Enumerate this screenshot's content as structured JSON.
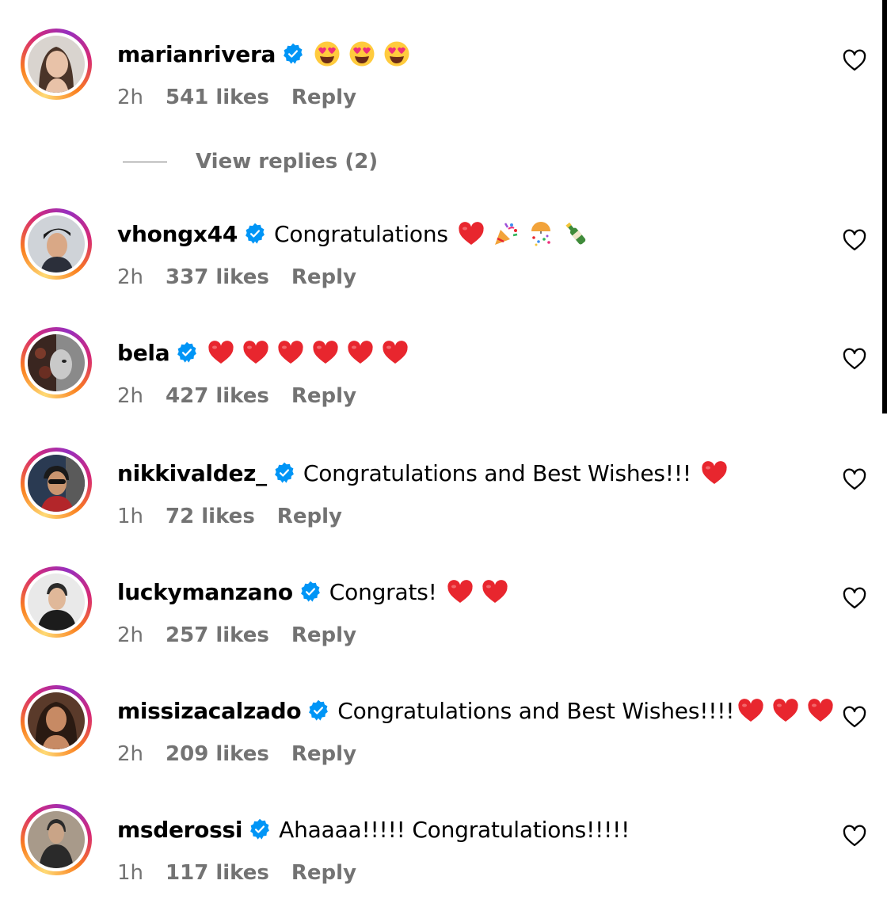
{
  "comments": [
    {
      "username": "marianrivera",
      "text": "",
      "emojis": [
        "heart-eyes",
        "heart-eyes",
        "heart-eyes"
      ],
      "time": "2h",
      "likes": "541 likes",
      "reply": "Reply"
    },
    {
      "username": "vhongx44",
      "text": "Congratulations",
      "emojis": [
        "red-heart",
        "party-popper",
        "confetti-ball",
        "champagne"
      ],
      "time": "2h",
      "likes": "337 likes",
      "reply": "Reply"
    },
    {
      "username": "bela",
      "text": "",
      "emojis": [
        "red-heart",
        "red-heart",
        "red-heart",
        "red-heart",
        "red-heart",
        "red-heart"
      ],
      "time": "2h",
      "likes": "427 likes",
      "reply": "Reply"
    },
    {
      "username": "nikkivaldez_",
      "text": "Congratulations and Best Wishes!!!",
      "emojis": [
        "red-heart"
      ],
      "time": "1h",
      "likes": "72 likes",
      "reply": "Reply"
    },
    {
      "username": "luckymanzano",
      "text": "Congrats!",
      "emojis": [
        "red-heart",
        "red-heart"
      ],
      "time": "2h",
      "likes": "257 likes",
      "reply": "Reply"
    },
    {
      "username": "missizacalzado",
      "text": "Congratulations and Best Wishes!!!!",
      "emojis": [
        "red-heart",
        "red-heart",
        "red-heart"
      ],
      "time": "2h",
      "likes": "209 likes",
      "reply": "Reply"
    },
    {
      "username": "msderossi",
      "text": "Ahaaaa!!!!! Congratulations!!!!!",
      "emojis": [],
      "time": "1h",
      "likes": "117 likes",
      "reply": "Reply"
    }
  ],
  "view_replies": "View replies (2)",
  "colors": {
    "verified": "#0095f6",
    "meta_text": "#737373",
    "heart": "#e8262e"
  }
}
